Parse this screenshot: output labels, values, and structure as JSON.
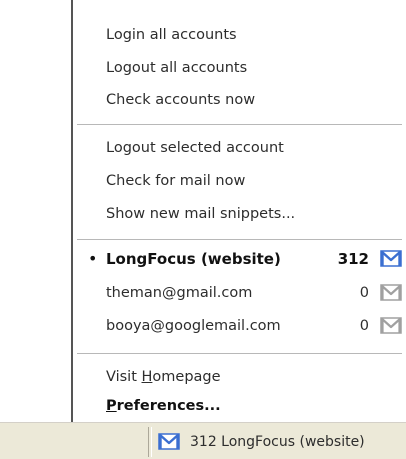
{
  "menu": {
    "group1": [
      {
        "label": "Login all accounts"
      },
      {
        "label": "Logout all accounts"
      },
      {
        "label": "Check accounts now"
      }
    ],
    "group2": [
      {
        "label": "Logout selected account"
      },
      {
        "label": "Check for mail now"
      },
      {
        "label": "Show new mail snippets..."
      }
    ],
    "accounts": [
      {
        "name": "LongFocus (website)",
        "count": "312",
        "selected": true,
        "icon": "gmail-icon",
        "icon_color": "#3b6fd1"
      },
      {
        "name": "theman@gmail.com",
        "count": "0",
        "selected": false,
        "icon": "gmail-icon",
        "icon_color": "#9a9a9a"
      },
      {
        "name": "booya@googlemail.com",
        "count": "0",
        "selected": false,
        "icon": "gmail-icon",
        "icon_color": "#9a9a9a"
      }
    ],
    "visit_homepage": {
      "pre": "Visit ",
      "accel": "H",
      "post": "omepage"
    },
    "preferences": {
      "accel": "P",
      "post": "references..."
    }
  },
  "statusbar": {
    "text": "312 LongFocus (website)",
    "icon": "gmail-icon",
    "icon_color": "#3b6fd1"
  }
}
